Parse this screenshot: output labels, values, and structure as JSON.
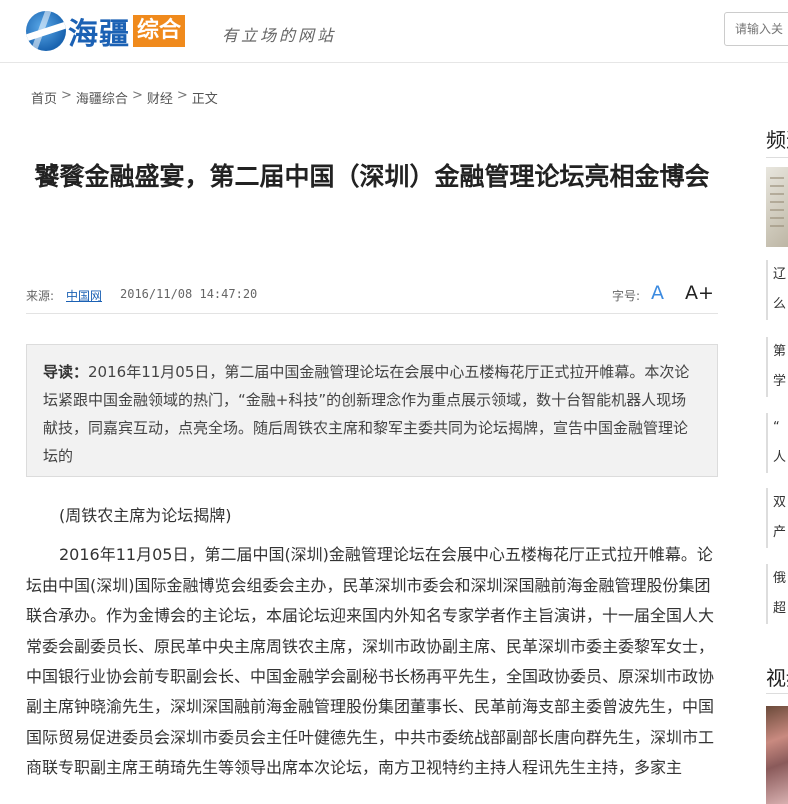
{
  "header": {
    "logo_text": "海疆",
    "logo_tag": "综合",
    "slogan": "有立场的网站",
    "search_placeholder": "请输入关"
  },
  "breadcrumb": {
    "home": "首页",
    "section": "海疆综合",
    "category": "财经",
    "current": "正文",
    "separator": ">"
  },
  "article": {
    "title": "饕餮金融盛宴，第二届中国（深圳）金融管理论坛亮相金博会",
    "source_label": "来源:",
    "source": "中国网",
    "datetime": "2016/11/08 14:47:20",
    "fontsize_label": "字号:",
    "fontsize_small": "A",
    "fontsize_big": "A+",
    "lead_label": "导读：",
    "lead_text": "2016年11月05日，第二届中国金融管理论坛在会展中心五楼梅花厅正式拉开帷幕。本次论坛紧跟中国金融领域的热门，“金融+科技”的创新理念作为重点展示领域，数十台智能机器人现场献技，同嘉宾互动，点亮全场。随后周铁农主席和黎军主委共同为论坛揭牌，宣告中国金融管理论坛的",
    "caption": "(周铁农主席为论坛揭牌)",
    "paragraph1": "2016年11月05日，第二届中国(深圳)金融管理论坛在会展中心五楼梅花厅正式拉开帷幕。论坛由中国(深圳)国际金融博览会组委会主办，民革深圳市委会和深圳深国融前海金融管理股份集团联合承办。作为金博会的主论坛，本届论坛迎来国内外知名专家学者作主旨演讲，十一届全国人大常委会副委员长、原民革中央主席周铁农主席，深圳市政协副主席、民革深圳市委主委黎军女士，中国银行业协会前专职副会长、中国金融学会副秘书长杨再平先生，全国政协委员、原深圳市政协副主席钟晓渝先生，深圳深国融前海金融管理股份集团董事长、民革前海支部主委曾波先生，中国国际贸易促进委员会深圳市委员会主任叶健德先生，中共市委统战部副部长唐向群先生，深圳市工商联专职副主席王萌琦先生等领导出席本次论坛，南方卫视特约主持人程讯先生主持，多家主"
  },
  "sidebar": {
    "head1": "频道",
    "head2": "视频",
    "items": [
      {
        "line1": "辽",
        "line2": "么"
      },
      {
        "line1": "第",
        "line2": "学"
      },
      {
        "line1": "“",
        "line2": "人"
      },
      {
        "line1": "双",
        "line2": "产"
      },
      {
        "line1": "俄",
        "line2": "超"
      }
    ]
  },
  "colors": {
    "brand_blue": "#1b61b4",
    "brand_orange": "#f08a1c",
    "link_blue": "#3d8be0",
    "lead_bg": "#f2f2f2"
  }
}
